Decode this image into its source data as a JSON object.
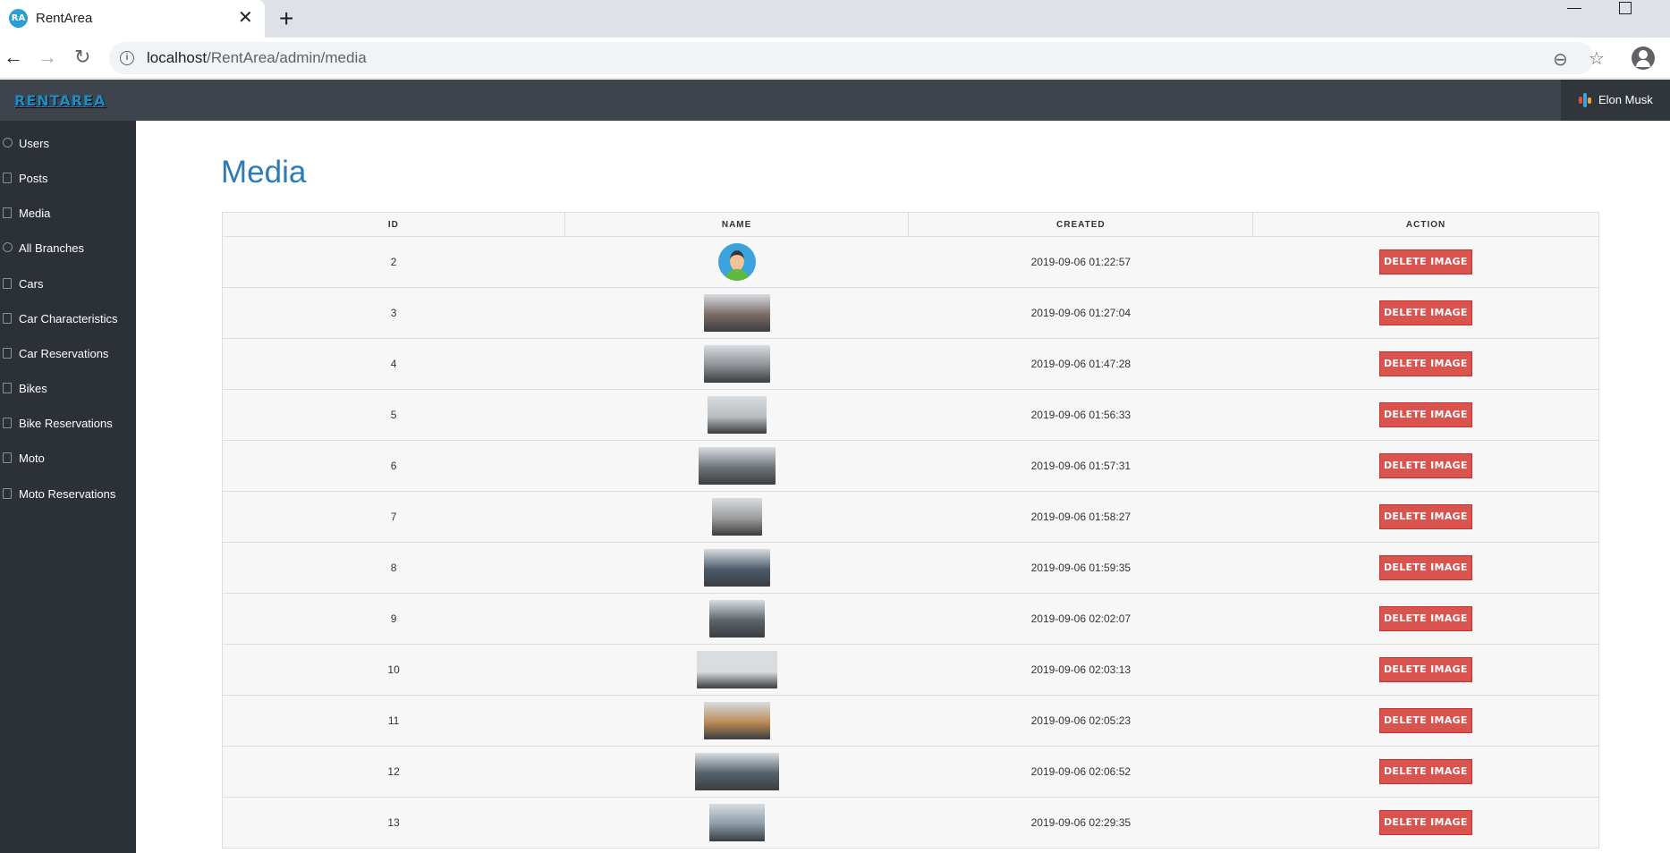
{
  "browser": {
    "tab_title": "RentArea",
    "favicon_text": "RA",
    "url_host": "localhost",
    "url_path": "/RentArea/admin/media"
  },
  "navbar": {
    "brand": "RENTAREA",
    "user_name": "Elon Musk"
  },
  "sidebar": {
    "items": [
      {
        "label": "Users",
        "icon": "user-icon"
      },
      {
        "label": "Posts",
        "icon": "file-icon"
      },
      {
        "label": "Media",
        "icon": "image-icon"
      },
      {
        "label": "All Branches",
        "icon": "globe-icon"
      },
      {
        "label": "Cars",
        "icon": "image-icon"
      },
      {
        "label": "Car Characteristics",
        "icon": "image-icon"
      },
      {
        "label": "Car Reservations",
        "icon": "file-icon"
      },
      {
        "label": "Bikes",
        "icon": "image-icon"
      },
      {
        "label": "Bike Reservations",
        "icon": "file-icon"
      },
      {
        "label": "Moto",
        "icon": "file-icon"
      },
      {
        "label": "Moto Reservations",
        "icon": "file-icon"
      }
    ]
  },
  "main": {
    "title": "Media",
    "table": {
      "headers": [
        "ID",
        "NAME",
        "CREATED",
        "ACTION"
      ],
      "action_label": "DELETE IMAGE",
      "rows": [
        {
          "id": "2",
          "created": "2019-09-06 01:22:57",
          "thumb": "avatar",
          "color": "#3aa3dc"
        },
        {
          "id": "3",
          "created": "2019-09-06 01:27:04",
          "thumb": "car",
          "color": "#7a6a66"
        },
        {
          "id": "4",
          "created": "2019-09-06 01:47:28",
          "thumb": "car",
          "color": "#8c8f93"
        },
        {
          "id": "5",
          "created": "2019-09-06 01:56:33",
          "thumb": "car",
          "color": "#b9bcbf"
        },
        {
          "id": "6",
          "created": "2019-09-06 01:57:31",
          "thumb": "car",
          "color": "#6e7378"
        },
        {
          "id": "7",
          "created": "2019-09-06 01:58:27",
          "thumb": "car",
          "color": "#9a9a9a"
        },
        {
          "id": "8",
          "created": "2019-09-06 01:59:35",
          "thumb": "car",
          "color": "#4c5a6a"
        },
        {
          "id": "9",
          "created": "2019-09-06 02:02:07",
          "thumb": "car",
          "color": "#5d636b"
        },
        {
          "id": "10",
          "created": "2019-09-06 02:03:13",
          "thumb": "car",
          "color": "#dcdcdc"
        },
        {
          "id": "11",
          "created": "2019-09-06 02:05:23",
          "thumb": "car",
          "color": "#b98a55"
        },
        {
          "id": "12",
          "created": "2019-09-06 02:06:52",
          "thumb": "car",
          "color": "#55606a"
        },
        {
          "id": "13",
          "created": "2019-09-06 02:29:35",
          "thumb": "bike",
          "color": "#8a9aa5"
        }
      ]
    }
  }
}
